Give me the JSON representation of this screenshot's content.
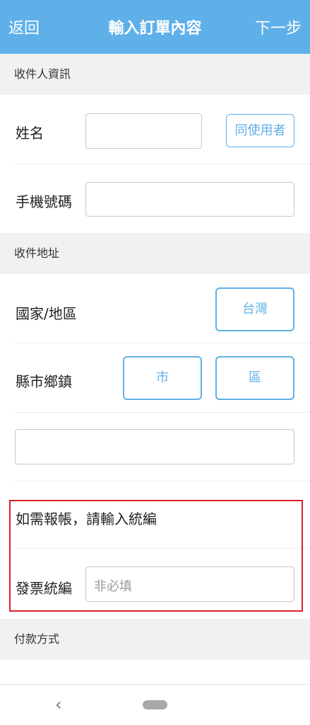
{
  "header": {
    "back_label": "返回",
    "title": "輸入訂單內容",
    "next_label": "下一步"
  },
  "recipient": {
    "section_title": "收件人資訊",
    "name_label": "姓名",
    "name_value": "",
    "same_as_user_button": "同使用者",
    "phone_label": "手機號碼",
    "phone_value": ""
  },
  "address": {
    "section_title": "收件地址",
    "country_label": "國家/地區",
    "country_value": "台灣",
    "city_label": "縣市鄉鎮",
    "city_button": "市",
    "district_button": "區",
    "detail_value": ""
  },
  "invoice": {
    "prompt": "如需報帳，請輸入統編",
    "tax_id_label": "發票統編",
    "tax_id_placeholder": "非必填"
  },
  "payment": {
    "section_title": "付款方式"
  },
  "colors": {
    "accent": "#5fb0e8",
    "highlight_border": "#d9202a",
    "section_bg": "#f1f1f1"
  },
  "navbar": {
    "back_icon": "chevron-left-icon",
    "home_icon": "home-pill-icon"
  }
}
